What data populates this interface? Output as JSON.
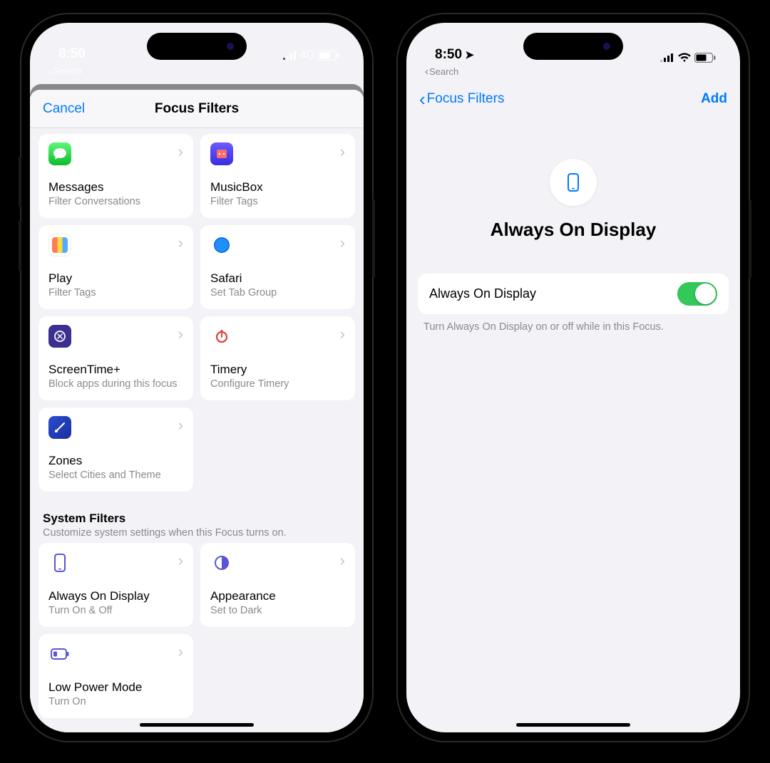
{
  "status": {
    "time": "8:50",
    "backSearch": "Search",
    "network": "4G"
  },
  "phone1": {
    "cancel": "Cancel",
    "title": "Focus Filters",
    "appFilters": [
      {
        "name": "Messages",
        "sub": "Filter Conversations",
        "icon": "messages"
      },
      {
        "name": "MusicBox",
        "sub": "Filter Tags",
        "icon": "musicbox"
      },
      {
        "name": "Play",
        "sub": "Filter Tags",
        "icon": "play"
      },
      {
        "name": "Safari",
        "sub": "Set Tab Group",
        "icon": "safari"
      },
      {
        "name": "ScreenTime+",
        "sub": "Block apps during this focus",
        "icon": "screentime"
      },
      {
        "name": "Timery",
        "sub": "Configure Timery",
        "icon": "timery"
      },
      {
        "name": "Zones",
        "sub": "Select Cities and Theme",
        "icon": "zones"
      }
    ],
    "systemHeader": "System Filters",
    "systemSub": "Customize system settings when this Focus turns on.",
    "systemFilters": [
      {
        "name": "Always On Display",
        "sub": "Turn On & Off",
        "icon": "phone"
      },
      {
        "name": "Appearance",
        "sub": "Set to Dark",
        "icon": "halfmoon"
      },
      {
        "name": "Low Power Mode",
        "sub": "Turn On",
        "icon": "battery"
      }
    ]
  },
  "phone2": {
    "back": "Focus Filters",
    "add": "Add",
    "heroTitle": "Always On Display",
    "settingLabel": "Always On Display",
    "settingOn": true,
    "footer": "Turn Always On Display on or off while in this Focus."
  }
}
